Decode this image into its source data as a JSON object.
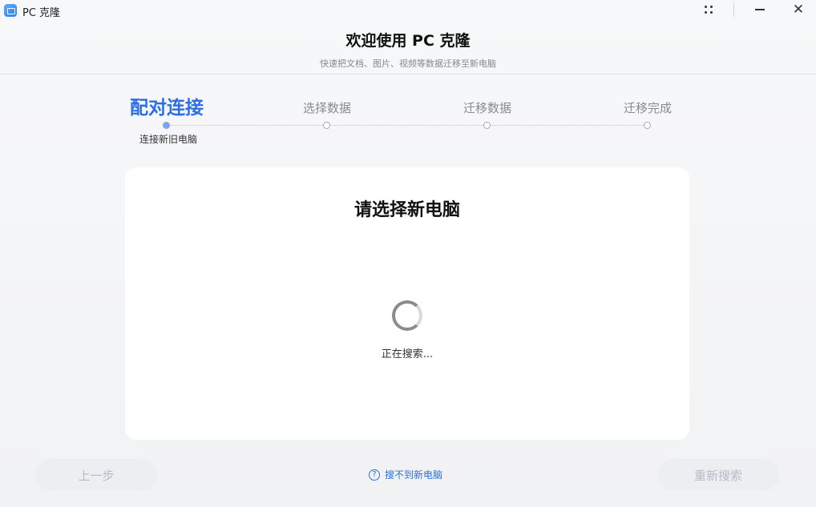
{
  "window": {
    "title": "PC 克隆",
    "controls": {
      "more_icon": "grid-dots-icon",
      "minimize_icon": "minimize-icon",
      "close_icon": "close-icon",
      "close_glyph": "✕"
    }
  },
  "header": {
    "title": "欢迎使用 PC 克隆",
    "subtitle": "快速把文档、图片、视频等数据迁移至新电脑"
  },
  "stepper": {
    "steps": [
      {
        "label": "配对连接",
        "state": "active",
        "sublabel": "连接新旧电脑"
      },
      {
        "label": "选择数据",
        "state": "pending"
      },
      {
        "label": "迁移数据",
        "state": "pending"
      },
      {
        "label": "迁移完成",
        "state": "pending"
      }
    ],
    "active_color": "#2c6fe3"
  },
  "card": {
    "title": "请选择新电脑",
    "status": "正在搜索..."
  },
  "footer": {
    "prev_label": "上一步",
    "help_label": "搜不到新电脑",
    "help_glyph": "?",
    "research_label": "重新搜索"
  }
}
